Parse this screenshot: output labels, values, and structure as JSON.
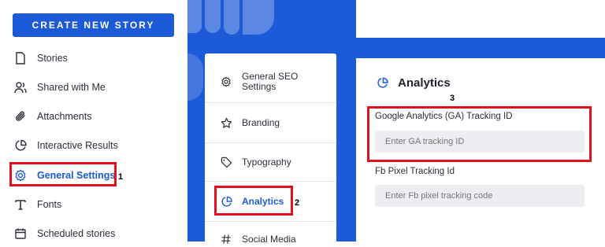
{
  "sidebar": {
    "create_button": "CREATE NEW STORY",
    "items": [
      {
        "label": "Stories",
        "icon": "file-icon"
      },
      {
        "label": "Shared with Me",
        "icon": "users-icon"
      },
      {
        "label": "Attachments",
        "icon": "paperclip-icon"
      },
      {
        "label": "Interactive Results",
        "icon": "pie-chart-icon"
      },
      {
        "label": "General Settings",
        "icon": "gear-icon"
      },
      {
        "label": "Fonts",
        "icon": "font-icon"
      },
      {
        "label": "Scheduled stories",
        "icon": "calendar-icon"
      }
    ]
  },
  "settings_menu": {
    "items": [
      {
        "label": "General SEO Settings",
        "icon": "gear-icon"
      },
      {
        "label": "Branding",
        "icon": "star-icon"
      },
      {
        "label": "Typography",
        "icon": "tag-icon"
      },
      {
        "label": "Analytics",
        "icon": "pie-chart-icon"
      },
      {
        "label": "Social Media",
        "icon": "hash-icon"
      }
    ]
  },
  "panel": {
    "title": "Analytics",
    "ga_label": "Google Analytics (GA) Tracking ID",
    "ga_placeholder": "Enter GA tracking ID",
    "fb_label": "Fb Pixel Tracking Id",
    "fb_placeholder": "Enter Fb pixel tracking code"
  },
  "markers": {
    "m1": "1",
    "m2": "2",
    "m3": "3"
  },
  "colors": {
    "accent": "#1d5ad8",
    "highlight": "#e0101c"
  }
}
